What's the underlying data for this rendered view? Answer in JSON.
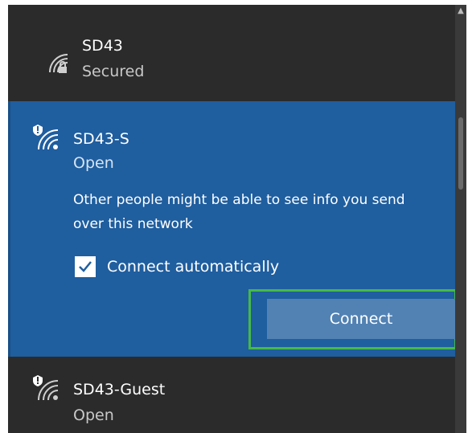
{
  "networks": [
    {
      "name": "SD43",
      "status": "Secured",
      "icon": "wifi-secured-icon"
    },
    {
      "name": "SD43-S",
      "status": "Open",
      "icon": "wifi-open-warning-icon",
      "info": "Other people might be able to see info you send over this network",
      "auto_connect_label": "Connect automatically",
      "auto_connect_checked": true,
      "connect_label": "Connect"
    },
    {
      "name": "SD43-Guest",
      "status": "Open",
      "icon": "wifi-open-warning-icon"
    }
  ],
  "colors": {
    "panel_bg": "#2b2b2b",
    "selected_bg": "#1f5e9f",
    "button_bg": "#5282b4",
    "highlight": "#46b946"
  }
}
